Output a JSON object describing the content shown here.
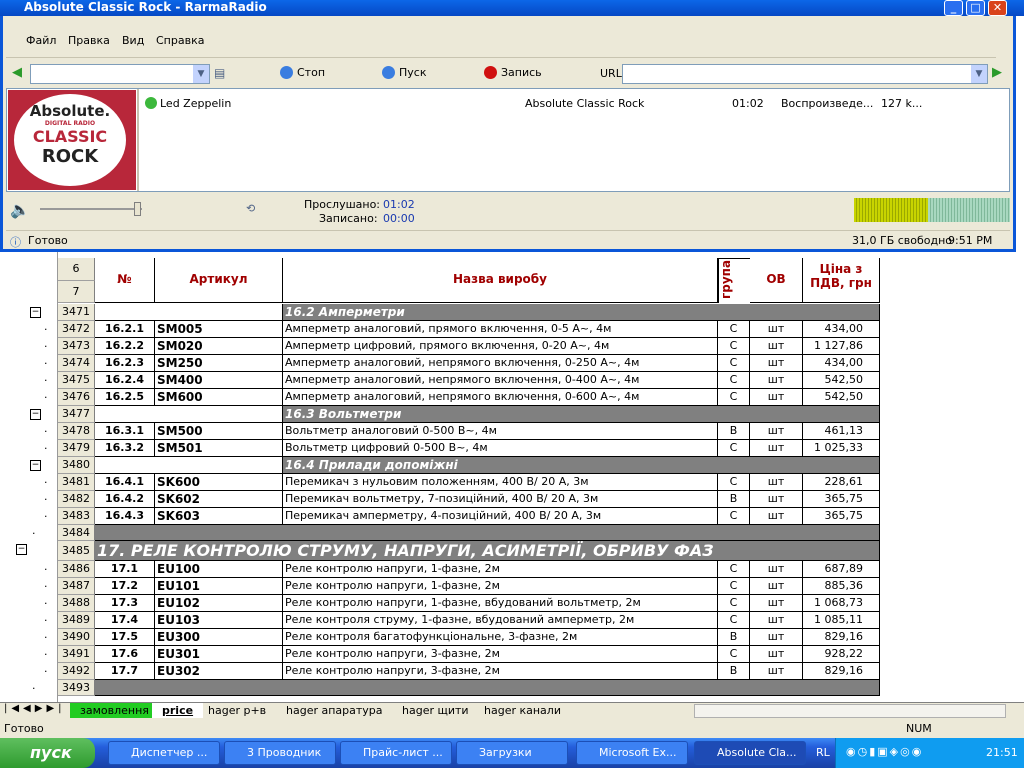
{
  "radio": {
    "title": "Absolute Classic Rock - RarmaRadio",
    "menu": [
      "Файл",
      "Правка",
      "Вид",
      "Справка"
    ],
    "toolbar": {
      "stop": "Стоп",
      "play": "Пуск",
      "record": "Запись",
      "url_label": "URL",
      "station_value": "",
      "url_value": ""
    },
    "now_playing": {
      "artist": "Led Zeppelin",
      "station": "Absolute Classic Rock",
      "time": "01:02",
      "state": "Воспроизведе...",
      "bitrate": "127 k..."
    },
    "logo": {
      "line1": "Absolute.",
      "line2": "DIGITAL RADIO",
      "line3": "CLASSIC",
      "line4": "ROCK"
    },
    "listened_label": "Прослушано:",
    "listened_value": "01:02",
    "recorded_label": "Записано:",
    "recorded_value": "00:00",
    "status": "Готово",
    "disk_free": "31,0 ГБ свободно",
    "clock": "9:51 PM"
  },
  "sheet": {
    "header": {
      "row_a": "6",
      "row_b": "7",
      "num": "№",
      "article": "Артикул",
      "name": "Назва виробу",
      "group": "група",
      "ov": "ОВ",
      "price": "Ціна з ПДВ, грн"
    },
    "rows": [
      {
        "r": "3471",
        "type": "sect",
        "name": "16.2 Амперметри"
      },
      {
        "r": "3472",
        "n": "16.2.1",
        "a": "SM005",
        "name": "Амперметр аналоговий, прямого включення, 0-5 А~, 4м",
        "g": "С",
        "ov": "шт",
        "p": "434,00"
      },
      {
        "r": "3473",
        "n": "16.2.2",
        "a": "SM020",
        "name": "Амперметр цифровий, прямого включення, 0-20 А~, 4м",
        "g": "С",
        "ov": "шт",
        "p": "1 127,86"
      },
      {
        "r": "3474",
        "n": "16.2.3",
        "a": "SM250",
        "name": "Амперметр аналоговий, непрямого включення, 0-250 А~, 4м",
        "g": "С",
        "ov": "шт",
        "p": "434,00"
      },
      {
        "r": "3475",
        "n": "16.2.4",
        "a": "SM400",
        "name": "Амперметр аналоговий, непрямого включення, 0-400 А~, 4м",
        "g": "С",
        "ov": "шт",
        "p": "542,50"
      },
      {
        "r": "3476",
        "n": "16.2.5",
        "a": "SM600",
        "name": "Амперметр аналоговий, непрямого включення, 0-600 А~, 4м",
        "g": "С",
        "ov": "шт",
        "p": "542,50"
      },
      {
        "r": "3477",
        "type": "sect",
        "name": "16.3 Вольтметри"
      },
      {
        "r": "3478",
        "n": "16.3.1",
        "a": "SM500",
        "name": "Вольтметр аналоговий 0-500 В~, 4м",
        "g": "В",
        "ov": "шт",
        "p": "461,13"
      },
      {
        "r": "3479",
        "n": "16.3.2",
        "a": "SM501",
        "name": "Вольтметр цифровий 0-500 В~, 4м",
        "g": "С",
        "ov": "шт",
        "p": "1 025,33"
      },
      {
        "r": "3480",
        "type": "sect",
        "name": "16.4 Прилади допоміжні"
      },
      {
        "r": "3481",
        "n": "16.4.1",
        "a": "SK600",
        "name": "Перемикач з нульовим положенням, 400 В/ 20 А, 3м",
        "g": "С",
        "ov": "шт",
        "p": "228,61"
      },
      {
        "r": "3482",
        "n": "16.4.2",
        "a": "SK602",
        "name": "Перемикач вольтметру, 7-позиційний, 400 В/ 20 А, 3м",
        "g": "В",
        "ov": "шт",
        "p": "365,75"
      },
      {
        "r": "3483",
        "n": "16.4.3",
        "a": "SK603",
        "name": "Перемикач амперметру, 4-позиційний, 400 В/ 20 А, 3м",
        "g": "С",
        "ov": "шт",
        "p": "365,75"
      },
      {
        "r": "3484",
        "type": "blank"
      },
      {
        "r": "3485",
        "type": "big",
        "name": "17. РЕЛЕ КОНТРОЛЮ СТРУМУ, НАПРУГИ, АСИМЕТРІЇ, ОБРИВУ ФАЗ"
      },
      {
        "r": "3486",
        "n": "17.1",
        "a": "EU100",
        "name": "Реле контролю напруги, 1-фазне, 2м",
        "g": "С",
        "ov": "шт",
        "p": "687,89"
      },
      {
        "r": "3487",
        "n": "17.2",
        "a": "EU101",
        "name": "Реле контролю напруги, 1-фазне, 2м",
        "g": "С",
        "ov": "шт",
        "p": "885,36"
      },
      {
        "r": "3488",
        "n": "17.3",
        "a": "EU102",
        "name": "Реле контролю напруги, 1-фазне, вбудований вольтметр, 2м",
        "g": "С",
        "ov": "шт",
        "p": "1 068,73"
      },
      {
        "r": "3489",
        "n": "17.4",
        "a": "EU103",
        "name": "Реле контроля струму, 1-фазне, вбудований амперметр, 2м",
        "g": "С",
        "ov": "шт",
        "p": "1 085,11"
      },
      {
        "r": "3490",
        "n": "17.5",
        "a": "EU300",
        "name": "Реле контроля багатофункціональне, 3-фазне, 2м",
        "g": "В",
        "ov": "шт",
        "p": "829,16"
      },
      {
        "r": "3491",
        "n": "17.6",
        "a": "EU301",
        "name": "Реле контролю напруги, 3-фазне, 2м",
        "g": "С",
        "ov": "шт",
        "p": "928,22"
      },
      {
        "r": "3492",
        "n": "17.7",
        "a": "EU302",
        "name": "Реле контролю напруги, 3-фазне, 2м",
        "g": "В",
        "ov": "шт",
        "p": "829,16"
      },
      {
        "r": "3493",
        "type": "blank"
      }
    ],
    "tabs": [
      "замовлення",
      "price",
      "hager p+в",
      "hager апаратура",
      "hager щити",
      "hager канали"
    ],
    "status": "Готово",
    "num": "NUM"
  },
  "taskbar": {
    "start": "пуск",
    "tasks": [
      "Диспетчер ...",
      "3 Проводник",
      "Прайс-лист ...",
      "Загрузки",
      "Microsoft Ex...",
      "Absolute Cla..."
    ],
    "lang": "RL",
    "clock": "21:51"
  }
}
